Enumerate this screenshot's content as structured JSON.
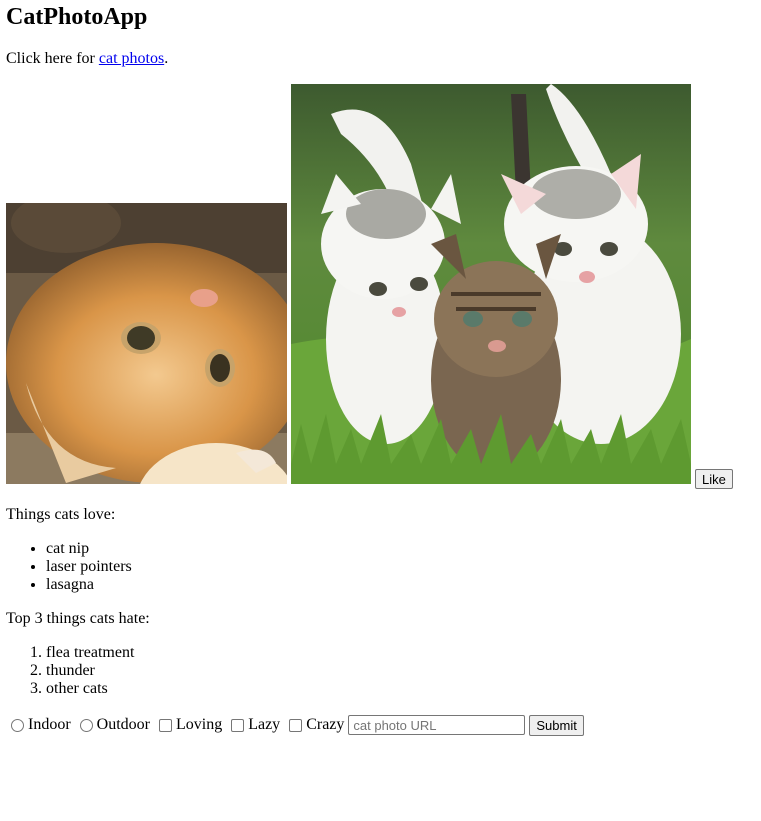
{
  "title": "CatPhotoApp",
  "intro": {
    "prefix": "Click here for ",
    "link_text": "cat photos",
    "suffix": "."
  },
  "photos": {
    "left_alt": "orange kitten lying on its back",
    "right_alt": "three kittens walking in grass"
  },
  "like_label": "Like",
  "love_heading": "Things cats love:",
  "love_items": [
    "cat nip",
    "laser pointers",
    "lasagna"
  ],
  "hate_heading": "Top 3 things cats hate:",
  "hate_items": [
    "flea treatment",
    "thunder",
    "other cats"
  ],
  "form": {
    "radios": [
      "Indoor",
      "Outdoor"
    ],
    "checkboxes": [
      "Loving",
      "Lazy",
      "Crazy"
    ],
    "url_placeholder": "cat photo URL",
    "url_value": "",
    "submit_label": "Submit"
  }
}
